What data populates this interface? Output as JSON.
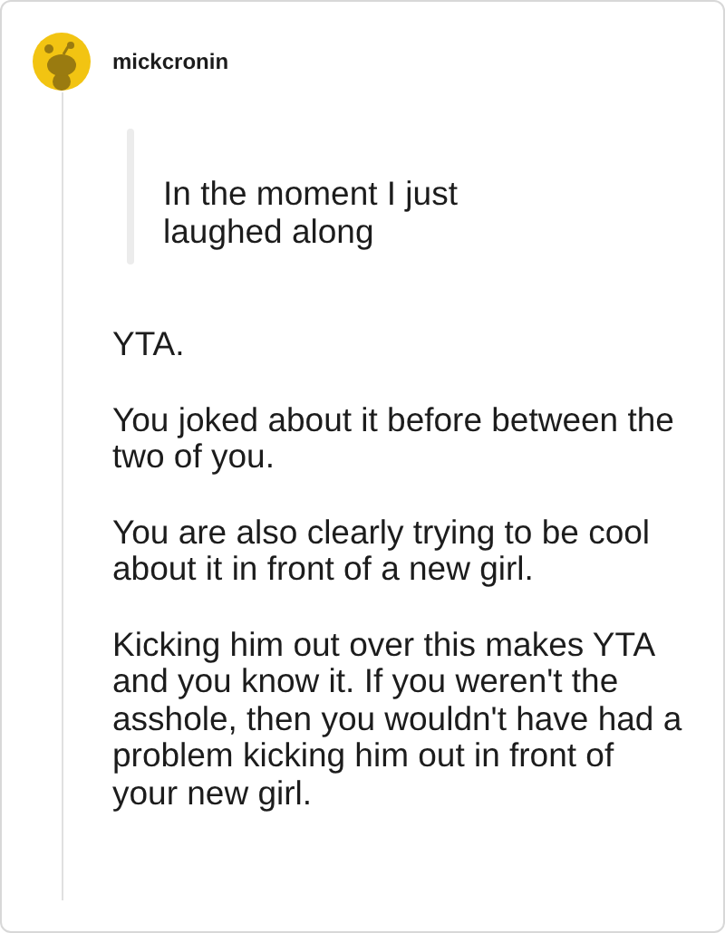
{
  "comment": {
    "author": "mickcronin",
    "quote": "In the moment I just laughed along",
    "paragraphs": [
      "YTA.",
      "You joked about it before between the two of you.",
      "You are also clearly trying to be cool about it in front of a new girl.",
      "Kicking him out over this makes YTA and you know it. If you weren't the asshole, then you wouldn't have had a problem kicking him out in front of your new girl."
    ]
  }
}
